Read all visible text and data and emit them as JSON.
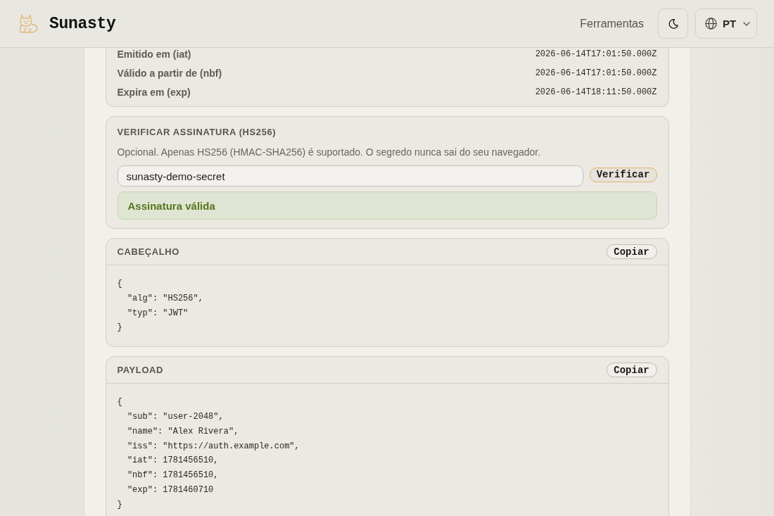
{
  "header": {
    "brand": "Sunasty",
    "nav_link": "Ferramentas",
    "language_button": "PT"
  },
  "claims": [
    {
      "label": "Emitido em (iat)",
      "value": "2026-06-14T17:01:50.000Z"
    },
    {
      "label": "Válido a partir de (nbf)",
      "value": "2026-06-14T17:01:50.000Z"
    },
    {
      "label": "Expira em (exp)",
      "value": "2026-06-14T18:11:50.000Z"
    }
  ],
  "signature": {
    "title": "VERIFICAR ASSINATURA (HS256)",
    "description": "Opcional. Apenas HS256 (HMAC-SHA256) é suportado. O segredo nunca sai do seu navegador.",
    "secret": {
      "value": "sunasty-demo-secret"
    },
    "verify_button": "Verificar",
    "result": {
      "valid": true,
      "text": "Assinatura válida"
    }
  },
  "sections": [
    {
      "title": "CABEÇALHO",
      "copy_button": "Copiar",
      "code": "{\n  \"alg\": \"HS256\",\n  \"typ\": \"JWT\"\n}"
    },
    {
      "title": "PAYLOAD",
      "copy_button": "Copiar",
      "code": "{\n  \"sub\": \"user-2048\",\n  \"name\": \"Alex Rivera\",\n  \"iss\": \"https://auth.example.com\",\n  \"iat\": 1781456510,\n  \"nbf\": 1781456510,\n  \"exp\": 1781460710\n}"
    }
  ]
}
